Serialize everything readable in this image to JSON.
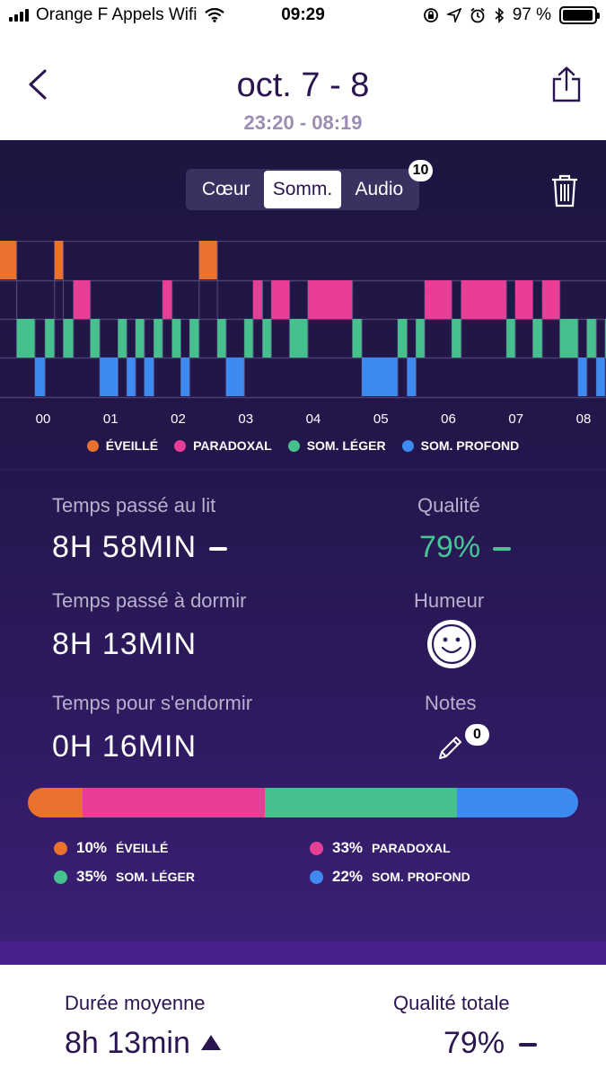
{
  "status_bar": {
    "carrier": "Orange F Appels Wifi",
    "time": "09:29",
    "battery": "97 %",
    "battery_level": 0.97
  },
  "header": {
    "title": "oct. 7 - 8",
    "subtitle": "23:20 - 08:19"
  },
  "segmented": {
    "items": [
      "Cœur",
      "Somm.",
      "Audio"
    ],
    "selected": "Somm.",
    "audio_badge": "10"
  },
  "colors": {
    "awake": "#e8722e",
    "rem": "#e83e96",
    "light": "#46c08c",
    "deep": "#3d8bf0",
    "quality": "#46c595"
  },
  "chart_data": {
    "type": "hypnogram",
    "x_tick_labels": [
      "00",
      "01",
      "02",
      "03",
      "04",
      "05",
      "06",
      "07",
      "08"
    ],
    "stages": [
      "ÉVEILLÉ",
      "PARADOXAL",
      "SOM. LÉGER",
      "SOM. PROFOND"
    ],
    "segments": [
      {
        "stage": "awake",
        "start": -0.65,
        "end": -0.39
      },
      {
        "stage": "light",
        "start": -0.39,
        "end": -0.12
      },
      {
        "stage": "deep",
        "start": -0.12,
        "end": 0.03
      },
      {
        "stage": "light",
        "start": 0.03,
        "end": 0.17
      },
      {
        "stage": "awake",
        "start": 0.17,
        "end": 0.3
      },
      {
        "stage": "light",
        "start": 0.3,
        "end": 0.45
      },
      {
        "stage": "rem",
        "start": 0.45,
        "end": 0.7
      },
      {
        "stage": "light",
        "start": 0.7,
        "end": 0.84
      },
      {
        "stage": "deep",
        "start": 0.84,
        "end": 1.11
      },
      {
        "stage": "light",
        "start": 1.11,
        "end": 1.24
      },
      {
        "stage": "deep",
        "start": 1.24,
        "end": 1.37
      },
      {
        "stage": "light",
        "start": 1.37,
        "end": 1.5
      },
      {
        "stage": "deep",
        "start": 1.5,
        "end": 1.64
      },
      {
        "stage": "light",
        "start": 1.64,
        "end": 1.77
      },
      {
        "stage": "rem",
        "start": 1.77,
        "end": 1.91
      },
      {
        "stage": "light",
        "start": 1.91,
        "end": 2.04
      },
      {
        "stage": "deep",
        "start": 2.04,
        "end": 2.17
      },
      {
        "stage": "light",
        "start": 2.17,
        "end": 2.31
      },
      {
        "stage": "awake",
        "start": 2.31,
        "end": 2.58
      },
      {
        "stage": "light",
        "start": 2.58,
        "end": 2.71
      },
      {
        "stage": "deep",
        "start": 2.71,
        "end": 2.98
      },
      {
        "stage": "light",
        "start": 2.98,
        "end": 3.11
      },
      {
        "stage": "rem",
        "start": 3.11,
        "end": 3.25
      },
      {
        "stage": "light",
        "start": 3.25,
        "end": 3.38
      },
      {
        "stage": "rem",
        "start": 3.38,
        "end": 3.65
      },
      {
        "stage": "light",
        "start": 3.65,
        "end": 3.92
      },
      {
        "stage": "rem",
        "start": 3.92,
        "end": 4.58
      },
      {
        "stage": "light",
        "start": 4.58,
        "end": 4.72
      },
      {
        "stage": "deep",
        "start": 4.72,
        "end": 5.25
      },
      {
        "stage": "light",
        "start": 5.25,
        "end": 5.39
      },
      {
        "stage": "deep",
        "start": 5.39,
        "end": 5.52
      },
      {
        "stage": "light",
        "start": 5.52,
        "end": 5.65
      },
      {
        "stage": "rem",
        "start": 5.65,
        "end": 6.05
      },
      {
        "stage": "light",
        "start": 6.05,
        "end": 6.19
      },
      {
        "stage": "rem",
        "start": 6.19,
        "end": 6.86
      },
      {
        "stage": "light",
        "start": 6.86,
        "end": 6.99
      },
      {
        "stage": "rem",
        "start": 6.99,
        "end": 7.25
      },
      {
        "stage": "light",
        "start": 7.25,
        "end": 7.39
      },
      {
        "stage": "rem",
        "start": 7.39,
        "end": 7.65
      },
      {
        "stage": "light",
        "start": 7.65,
        "end": 7.92
      },
      {
        "stage": "deep",
        "start": 7.92,
        "end": 8.05
      },
      {
        "stage": "light",
        "start": 8.05,
        "end": 8.19
      },
      {
        "stage": "deep",
        "start": 8.19,
        "end": 8.32
      },
      {
        "stage": "light",
        "start": 8.32,
        "end": 8.45
      },
      {
        "stage": "awake",
        "start": 8.45,
        "end": 8.5
      }
    ]
  },
  "legend_top": [
    {
      "label": "ÉVEILLÉ",
      "color": "#e8722e"
    },
    {
      "label": "PARADOXAL",
      "color": "#e83e96"
    },
    {
      "label": "SOM. LÉGER",
      "color": "#46c08c"
    },
    {
      "label": "SOM. PROFOND",
      "color": "#3d8bf0"
    }
  ],
  "stats": {
    "bed_label": "Temps passé au lit",
    "bed_value": "8H 58MIN",
    "sleep_label": "Temps passé à dormir",
    "sleep_value": "8H 13MIN",
    "fall_label": "Temps pour s'endormir",
    "fall_value": "0H 16MIN",
    "quality_label": "Qualité",
    "quality_value": "79%",
    "mood_label": "Humeur",
    "notes_label": "Notes",
    "notes_badge": "0"
  },
  "breakdown": [
    {
      "pct": "10%",
      "label": "ÉVEILLÉ",
      "value": 0.1,
      "color": "#e8722e"
    },
    {
      "pct": "33%",
      "label": "PARADOXAL",
      "value": 0.33,
      "color": "#e83e96"
    },
    {
      "pct": "35%",
      "label": "SOM. LÉGER",
      "value": 0.35,
      "color": "#46c08c"
    },
    {
      "pct": "22%",
      "label": "SOM. PROFOND",
      "value": 0.22,
      "color": "#3d8bf0"
    }
  ],
  "bottom": {
    "avg_label": "Durée moyenne",
    "avg_value": "8h 13min",
    "total_label": "Qualité totale",
    "total_value": "79%"
  }
}
